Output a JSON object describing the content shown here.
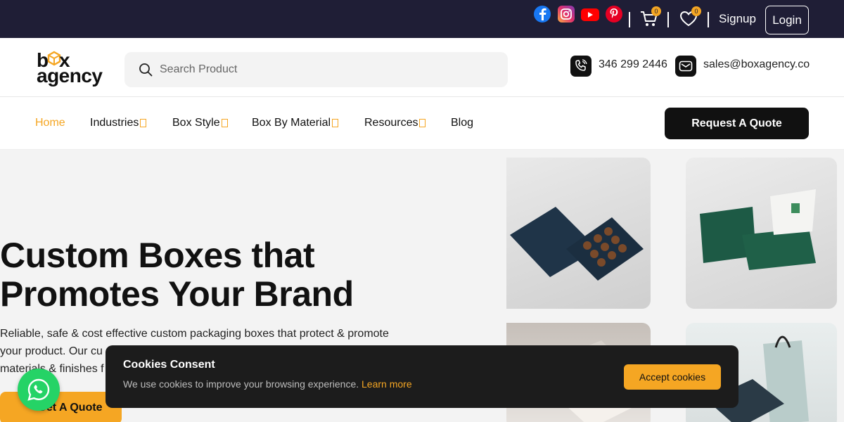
{
  "topbar": {
    "social_icons": [
      "facebook-icon",
      "instagram-icon",
      "youtube-icon",
      "pinterest-icon"
    ],
    "cart_count": "0",
    "wishlist_count": "0",
    "signup_label": "Signup",
    "login_label": "Login"
  },
  "header": {
    "logo_line1_b": "b",
    "logo_line1_x": "x",
    "logo_line2": "agency",
    "search_placeholder": "Search Product",
    "phone": "346 299 2446",
    "email": "sales@boxagency.co"
  },
  "nav": {
    "items": [
      "Home",
      "Industries",
      "Box Style",
      "Box By Material",
      "Resources",
      "Blog"
    ],
    "quote_label": "Request A Quote"
  },
  "hero": {
    "title_line1": "Custom Boxes that",
    "title_line2": "Promotes Your Brand",
    "desc_line1": "Reliable, safe & cost effective custom packaging boxes that protect & promote",
    "desc_line2": "your product. Our cu",
    "desc_line3": "materials & finishes f",
    "cta_label": "Get A Quote"
  },
  "cookie": {
    "title": "Cookies Consent",
    "text": "We use cookies to improve your browsing experience.",
    "link": "Learn more",
    "accept_label": "Accept cookies"
  },
  "colors": {
    "topbar_bg": "#1f1e36",
    "accent": "#f5a623",
    "dark": "#111111"
  }
}
